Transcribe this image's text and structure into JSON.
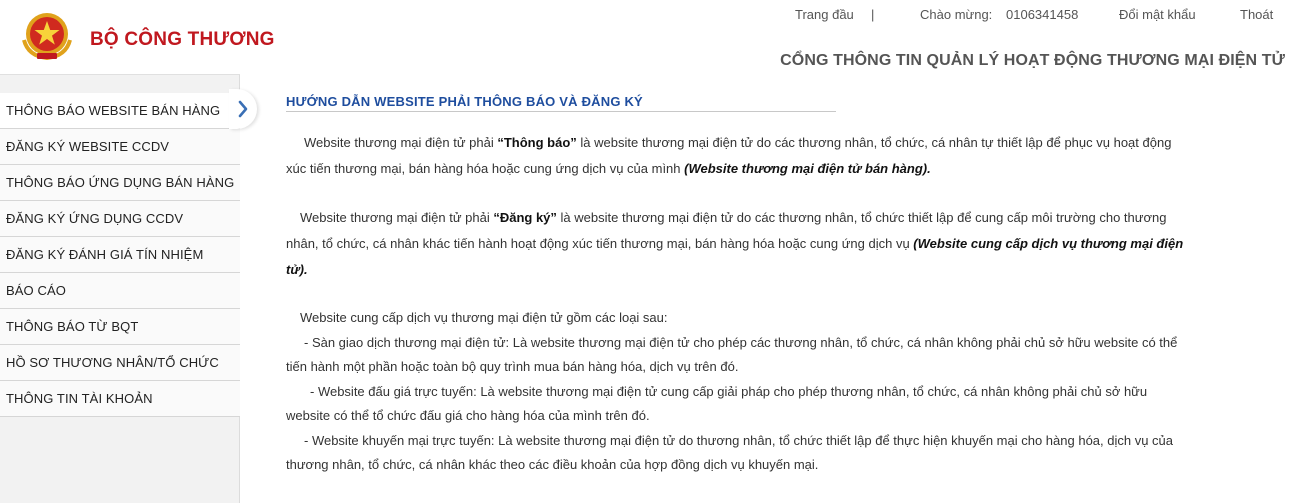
{
  "header": {
    "brand": "BỘ CÔNG THƯƠNG",
    "portal_title": "CỔNG THÔNG TIN QUẢN LÝ HOẠT ĐỘNG THƯƠNG MẠI ĐIỆN TỬ",
    "nav": {
      "home": "Trang đầu",
      "separator": "|",
      "welcome_label": "Chào mừng:",
      "username": "0106341458",
      "change_password": "Đổi mật khẩu",
      "logout": "Thoát"
    },
    "colors": {
      "brand": "#c0181f",
      "title": "#1e4d9e"
    }
  },
  "sidebar": {
    "items": [
      {
        "label": "THÔNG BÁO WEBSITE BÁN HÀNG",
        "active": true
      },
      {
        "label": "ĐĂNG KÝ WEBSITE CCDV"
      },
      {
        "label": "THÔNG BÁO ỨNG DỤNG BÁN HÀNG"
      },
      {
        "label": "ĐĂNG KÝ ỨNG DỤNG CCDV"
      },
      {
        "label": "ĐĂNG KÝ ĐÁNH GIÁ TÍN NHIỆM"
      },
      {
        "label": "BÁO CÁO"
      },
      {
        "label": "THÔNG BÁO TỪ BQT"
      },
      {
        "label": "HỒ SƠ THƯƠNG NHÂN/TỔ CHỨC"
      },
      {
        "label": "THÔNG TIN TÀI KHOẢN"
      }
    ],
    "active_icon": "chevron-right-icon"
  },
  "content": {
    "title": "HƯỚNG DẪN WEBSITE PHẢI THÔNG BÁO VÀ ĐĂNG KÝ",
    "p1": {
      "a": "Website thương mại điện tử phải ",
      "b": "“Thông báo”",
      "c": " là website thương mại điện tử do các thương nhân, tổ chức, cá nhân tự thiết lập để phục vụ hoạt động xúc tiến thương mại, bán hàng hóa hoặc cung ứng dịch vụ của mình ",
      "d": "(Website thương mại điện tử bán hàng)."
    },
    "p2": {
      "a": "Website thương mại điện tử phải ",
      "b": "“Đăng ký”",
      "c": " là website thương mại điện tử do các thương nhân, tổ chức thiết lập để cung cấp môi trường cho thương nhân, tổ chức, cá nhân khác tiến hành hoạt động xúc tiến thương mại, bán hàng hóa hoặc cung ứng dịch vụ ",
      "d": "(Website cung cấp dịch vụ thương mại điện tử)."
    },
    "p3": {
      "intro": "Website cung cấp dịch vụ thương mại điện tử gồm các loại sau:",
      "item1": "- Sàn giao dịch thương mại điện tử: Là website thương mại điện tử cho phép các thương nhân, tổ chức, cá nhân không phải chủ sở hữu website có thể tiến hành một phần hoặc toàn bộ quy trình mua bán hàng hóa, dịch vụ trên đó.",
      "item2": "- Website đấu giá trực tuyến: Là website thương mại điện tử cung cấp giải pháp cho phép thương nhân, tổ chức, cá nhân không phải chủ sở hữu website có thể tổ chức đấu giá cho hàng hóa của mình trên đó.",
      "item3": "- Website khuyến mại trực tuyến: Là website thương mại điện tử do thương nhân, tổ chức thiết lập để thực hiện khuyến mại cho hàng hóa, dịch vụ của thương nhân, tổ chức, cá nhân khác theo các điều khoản của hợp đồng dịch vụ khuyến mại."
    }
  }
}
